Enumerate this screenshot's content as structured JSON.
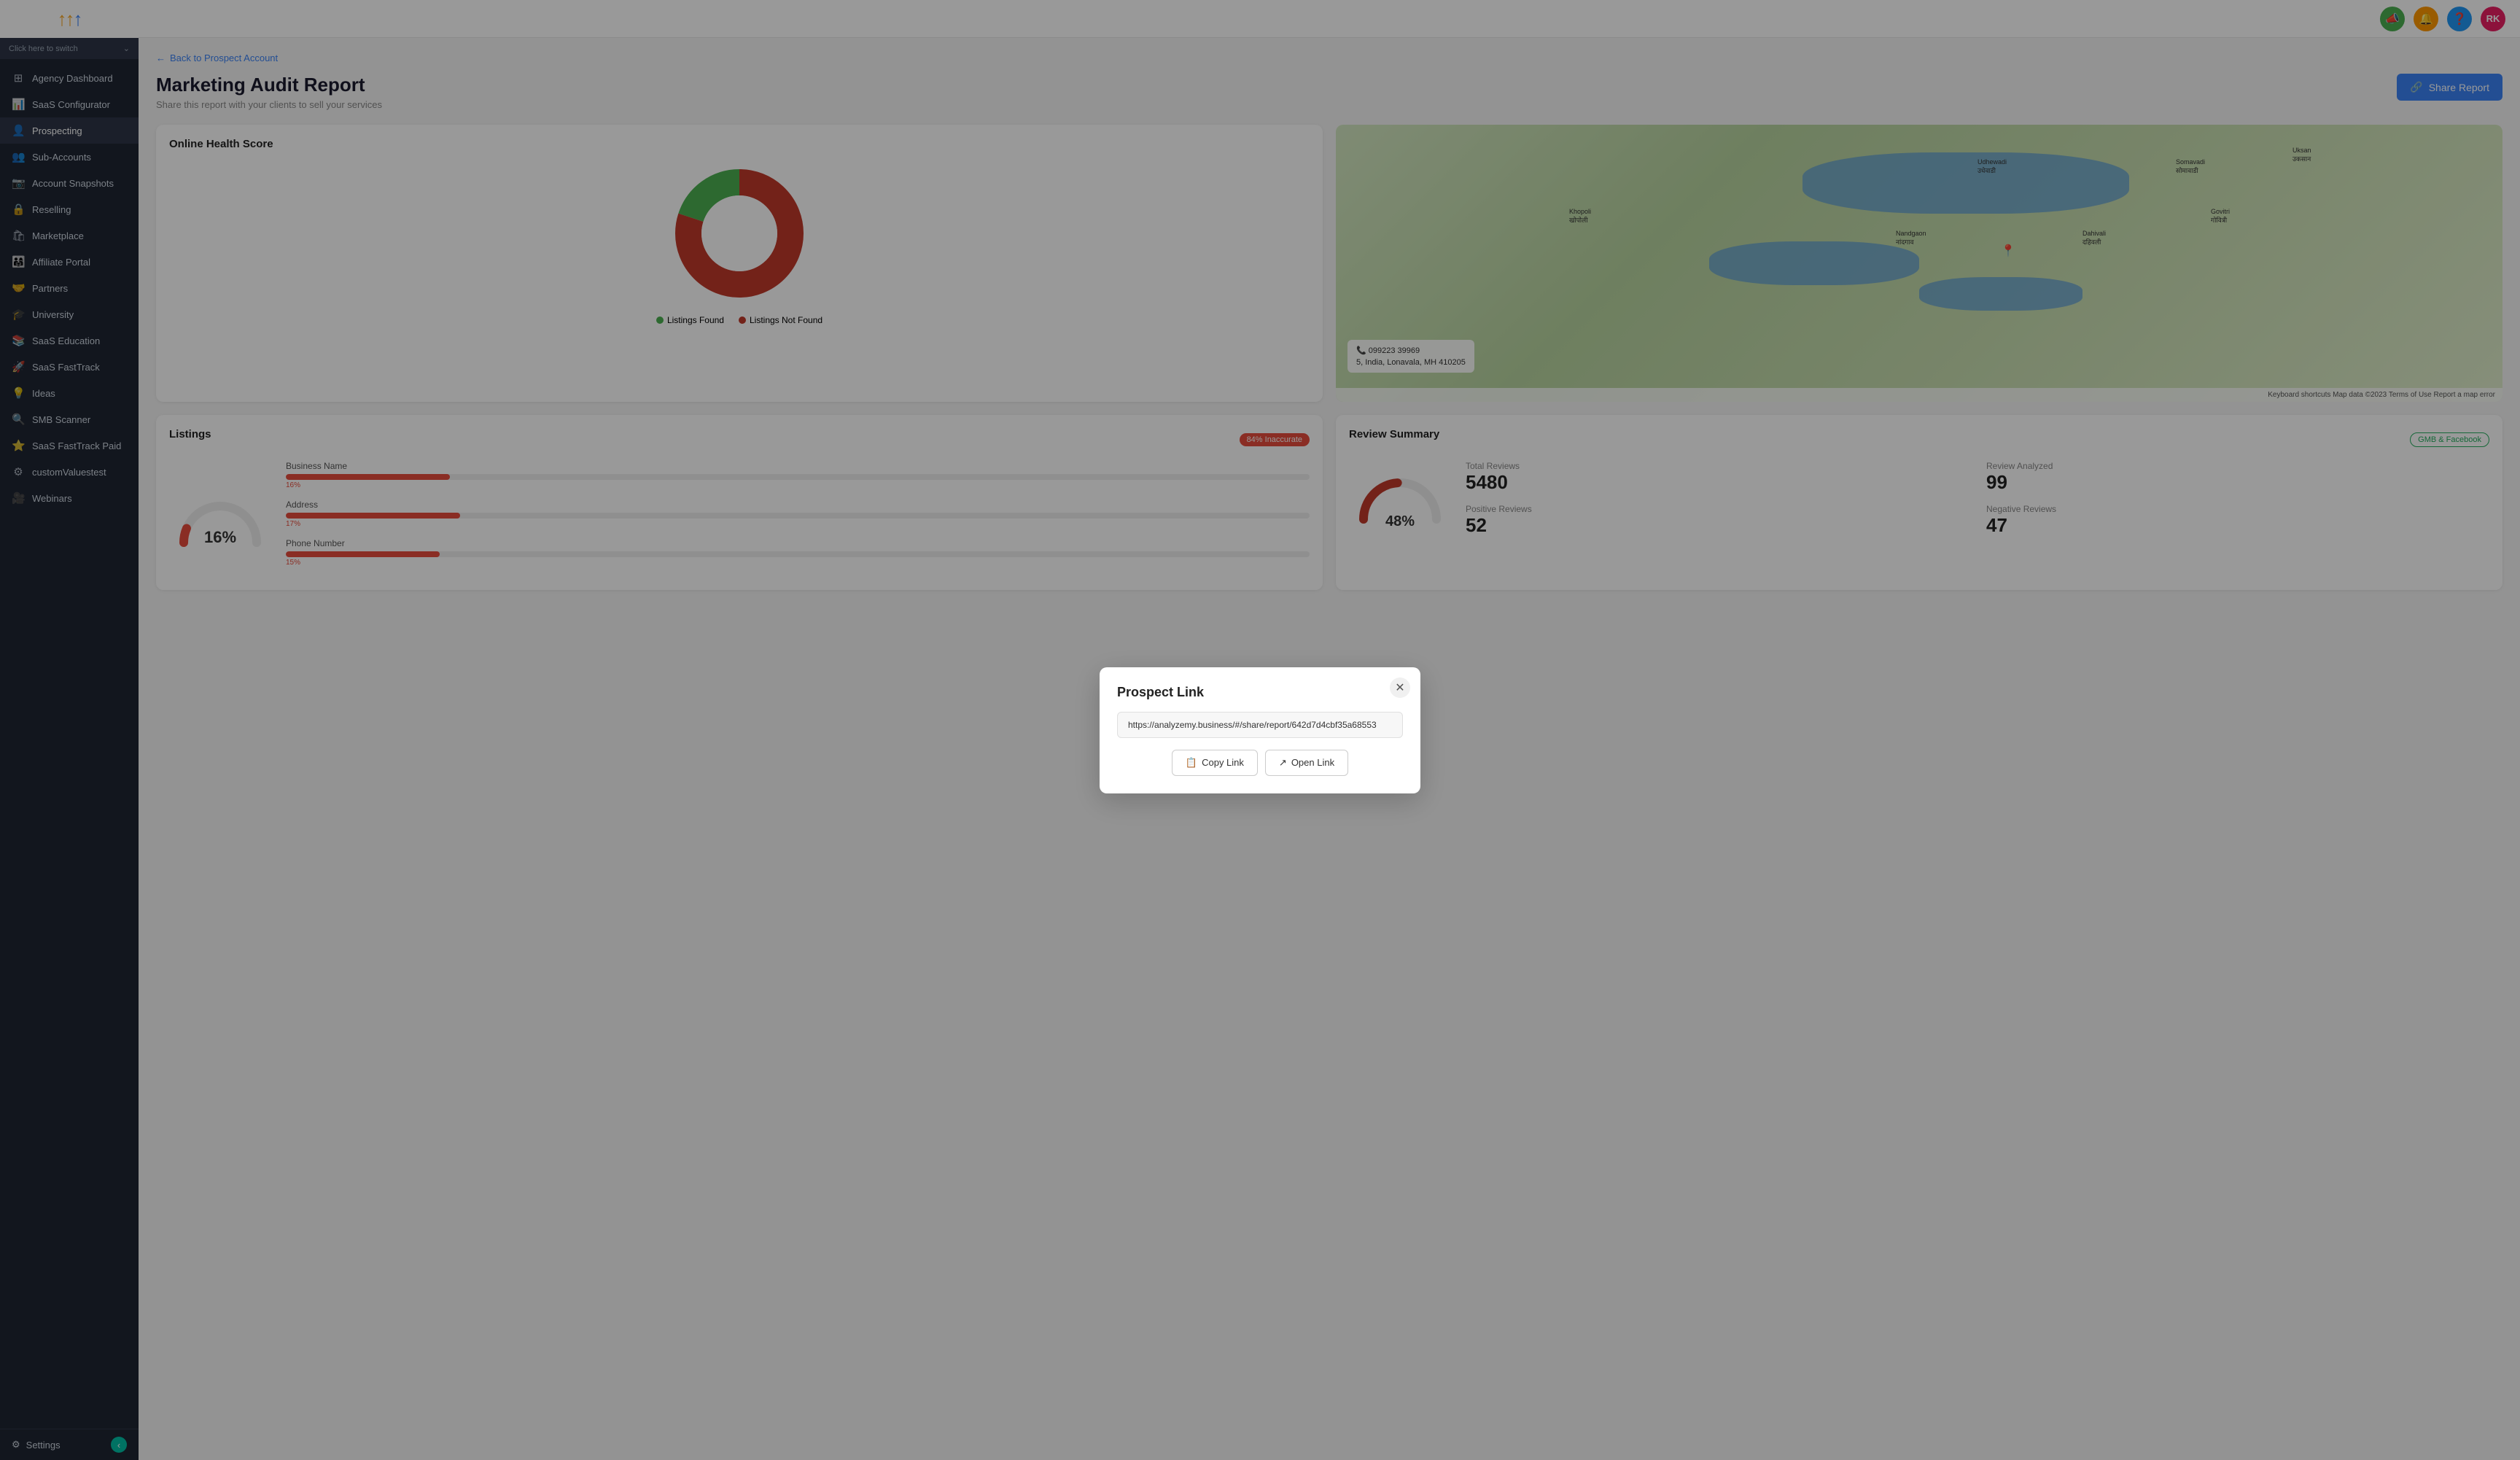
{
  "sidebar": {
    "logo_text": "↑↑",
    "switch_label": "Click here to switch",
    "items": [
      {
        "id": "agency-dashboard",
        "label": "Agency Dashboard",
        "icon": "⊞"
      },
      {
        "id": "saas-configurator",
        "label": "SaaS Configurator",
        "icon": "📊"
      },
      {
        "id": "prospecting",
        "label": "Prospecting",
        "icon": "👤",
        "active": true
      },
      {
        "id": "sub-accounts",
        "label": "Sub-Accounts",
        "icon": "👥"
      },
      {
        "id": "account-snapshots",
        "label": "Account Snapshots",
        "icon": "📷"
      },
      {
        "id": "reselling",
        "label": "Reselling",
        "icon": "🔒"
      },
      {
        "id": "marketplace",
        "label": "Marketplace",
        "icon": "🛍"
      },
      {
        "id": "affiliate-portal",
        "label": "Affiliate Portal",
        "icon": "👨‍👩‍👧"
      },
      {
        "id": "partners",
        "label": "Partners",
        "icon": "🤝"
      },
      {
        "id": "university",
        "label": "University",
        "icon": "🎓"
      },
      {
        "id": "saas-education",
        "label": "SaaS Education",
        "icon": "📚"
      },
      {
        "id": "saas-fasttrack",
        "label": "SaaS FastTrack",
        "icon": "🚀"
      },
      {
        "id": "ideas",
        "label": "Ideas",
        "icon": "💡"
      },
      {
        "id": "smb-scanner",
        "label": "SMB Scanner",
        "icon": "🔍"
      },
      {
        "id": "saas-fasttrack-paid",
        "label": "SaaS FastTrack Paid",
        "icon": "⭐"
      },
      {
        "id": "custom-values",
        "label": "customValuestest",
        "icon": "⚙"
      },
      {
        "id": "webinars",
        "label": "Webinars",
        "icon": "🎥"
      }
    ],
    "settings_label": "Settings"
  },
  "topbar": {
    "icons": [
      "📣",
      "🔔",
      "❓"
    ],
    "avatar_label": "RK"
  },
  "header": {
    "back_label": "Back to Prospect Account",
    "page_title": "Marketing Audit Report",
    "page_subtitle": "Share this report with your clients to sell your services",
    "share_btn_label": "Share Report"
  },
  "online_health": {
    "title": "Online Health Score",
    "listings_found_label": "Listings Found",
    "listings_not_found_label": "Listings Not Found",
    "found_pct": 20,
    "not_found_pct": 80
  },
  "map": {
    "address": "5, India, Lonavala, MH 410205",
    "phone": "099223 39969",
    "map_footer": "Keyboard shortcuts  Map data ©2023  Terms of Use  Report a map error"
  },
  "listings": {
    "title": "Listings",
    "badge_label": "84% Inaccurate",
    "gauge_pct": "16%",
    "bars": [
      {
        "label": "Business Name",
        "pct": 16
      },
      {
        "label": "Address",
        "pct": 17
      },
      {
        "label": "Phone Number",
        "pct": 15
      }
    ]
  },
  "review_summary": {
    "title": "Review Summary",
    "badge_label": "GMB & Facebook",
    "gauge_pct": "48%",
    "stats": [
      {
        "label": "Total Reviews",
        "value": "5480"
      },
      {
        "label": "Review Analyzed",
        "value": "99"
      },
      {
        "label": "Positive Reviews",
        "value": "52"
      },
      {
        "label": "Negative Reviews",
        "value": "47"
      }
    ]
  },
  "modal": {
    "title": "Prospect Link",
    "url": "https://analyzemy.business/#/share/report/642d7d4cbf35a68553",
    "copy_label": "Copy Link",
    "open_label": "Open Link"
  }
}
